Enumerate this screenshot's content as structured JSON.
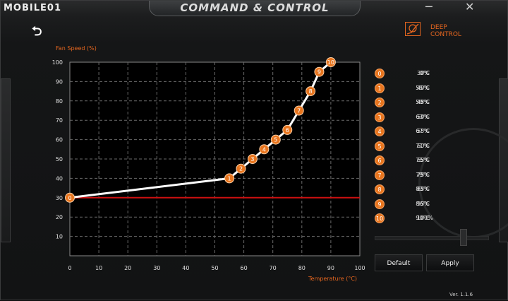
{
  "window": {
    "brand": "MOBILE01",
    "title": "COMMAND & CONTROL",
    "minimize": "─",
    "close": "✕",
    "back": "⮌",
    "version": "Ver. 1.1.6"
  },
  "logo": {
    "line1": "DEEP",
    "line2": "CONTROL",
    "icon": "fan-curve-icon"
  },
  "buttons": {
    "default": "Default",
    "apply": "Apply"
  },
  "legend": [
    {
      "n": "0",
      "temp": "0°C",
      "speed": "30%"
    },
    {
      "n": "1",
      "temp": "55°C",
      "speed": "40%"
    },
    {
      "n": "2",
      "temp": "59°C",
      "speed": "45%"
    },
    {
      "n": "3",
      "temp": "63°C",
      "speed": "50%"
    },
    {
      "n": "4",
      "temp": "67°C",
      "speed": "55%"
    },
    {
      "n": "5",
      "temp": "71°C",
      "speed": "60%"
    },
    {
      "n": "6",
      "temp": "75°C",
      "speed": "65%"
    },
    {
      "n": "7",
      "temp": "79°C",
      "speed": "75%"
    },
    {
      "n": "8",
      "temp": "83°C",
      "speed": "85%"
    },
    {
      "n": "9",
      "temp": "86°C",
      "speed": "95%"
    },
    {
      "n": "10",
      "temp": "90°C",
      "speed": "100%"
    }
  ],
  "chart_data": {
    "type": "line",
    "xlabel": "Temperature (°C)",
    "ylabel": "Fan Speed (%)",
    "xlim": [
      0,
      100
    ],
    "ylim": [
      0,
      100
    ],
    "xticks": [
      0,
      10,
      20,
      30,
      40,
      50,
      60,
      70,
      80,
      90,
      100
    ],
    "yticks": [
      10,
      20,
      30,
      40,
      50,
      60,
      70,
      80,
      90,
      100
    ],
    "grid": true,
    "baseline": 30,
    "points": [
      {
        "label": "0",
        "x": 0,
        "y": 30
      },
      {
        "label": "1",
        "x": 55,
        "y": 40
      },
      {
        "label": "2",
        "x": 59,
        "y": 45
      },
      {
        "label": "3",
        "x": 63,
        "y": 50
      },
      {
        "label": "4",
        "x": 67,
        "y": 55
      },
      {
        "label": "5",
        "x": 71,
        "y": 60
      },
      {
        "label": "6",
        "x": 75,
        "y": 65
      },
      {
        "label": "7",
        "x": 79,
        "y": 75
      },
      {
        "label": "8",
        "x": 83,
        "y": 85
      },
      {
        "label": "9",
        "x": 86,
        "y": 95
      },
      {
        "label": "10",
        "x": 90,
        "y": 100
      }
    ],
    "colors": {
      "line": "#ffffff",
      "baseline": "#cc1010",
      "marker": "#e8751e",
      "axis_label": "#e5661f",
      "grid": "#6a6a6a"
    }
  }
}
